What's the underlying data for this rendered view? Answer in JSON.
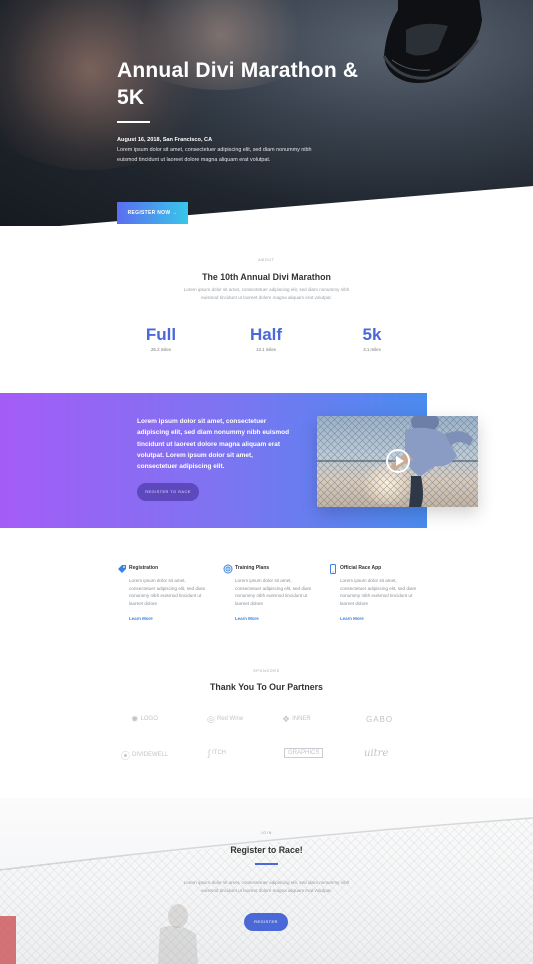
{
  "hero": {
    "title": "Annual Divi Marathon & 5K",
    "date_location": "August 16, 2018, San Francisco, CA",
    "description": "Lorem ipsum dolor sit amet, consectetuer adipiscing elit, sed diam nonummy nibh euismod tincidunt ut laoreet dolore magna aliquam erat volutpat.",
    "cta_label": "REGISTER NOW →"
  },
  "about": {
    "eyebrow": "ABOUT",
    "title": "The 10th Annual Divi Marathon",
    "text": "Lorem ipsum dolor sit amet, consectetuer adipiscing elit, sed diam nonummy nibh euismod tincidunt ut laoreet dolore magna aliquam erat volutpat.",
    "stats": [
      {
        "value": "Full",
        "label": "26.2 miles"
      },
      {
        "value": "Half",
        "label": "13.1 miles"
      },
      {
        "value": "5k",
        "label": "3.1 miles"
      }
    ]
  },
  "promo": {
    "text": "Lorem ipsum dolor sit amet, consectetuer adipiscing elit, sed diam nonummy nibh euismod tincidunt ut laoreet dolore magna aliquam erat volutpat. Lorem ipsum dolor sit amet, consectetuer adipiscing elit.",
    "button_label": "REGISTER TO RACE"
  },
  "features": [
    {
      "icon": "tag-icon",
      "title": "Registration",
      "text": "Lorem ipsum dolor sit amet, consectetuer adipiscing elit, sed diam nonummy nibh euismod tincidunt ut laoreet dolore",
      "link": "Learn More"
    },
    {
      "icon": "target-icon",
      "title": "Training Plans",
      "text": "Lorem ipsum dolor sit amet, consectetuer adipiscing elit, sed diam nonummy nibh euismod tincidunt ut laoreet dolore",
      "link": "Learn More"
    },
    {
      "icon": "phone-icon",
      "title": "Official Race App",
      "text": "Lorem ipsum dolor sit amet, consectetuer adipiscing elit, sed diam nonummy nibh euismod tincidunt ut laoreet dolore",
      "link": "Learn More"
    }
  ],
  "partners": {
    "eyebrow": "SPONSORS",
    "title": "Thank You To Our Partners",
    "logos": [
      {
        "name": "logo-1",
        "text": "LOGO"
      },
      {
        "name": "logo-2",
        "text": "Red Wine"
      },
      {
        "name": "logo-3",
        "text": "INNER"
      },
      {
        "name": "logo-4",
        "text": "GABO"
      },
      {
        "name": "logo-5",
        "text": "DIVIDEWELL"
      },
      {
        "name": "logo-6",
        "text": "ITCH"
      },
      {
        "name": "logo-7",
        "text": "GRAPHICS"
      },
      {
        "name": "logo-8",
        "text": "uitre"
      }
    ]
  },
  "register": {
    "eyebrow": "JOIN",
    "title": "Register to Race!",
    "text": "Lorem ipsum dolor sit amet, consectetuer adipiscing elit, sed diam nonummy nibh euismod tincidunt ut laoreet dolore magna aliquam erat volutpat.",
    "button_label": "REGISTER"
  },
  "colors": {
    "accent": "#4a68d8",
    "gradient_start": "#a45cf7",
    "gradient_end": "#4a8bf0",
    "link": "#3b83e0"
  }
}
